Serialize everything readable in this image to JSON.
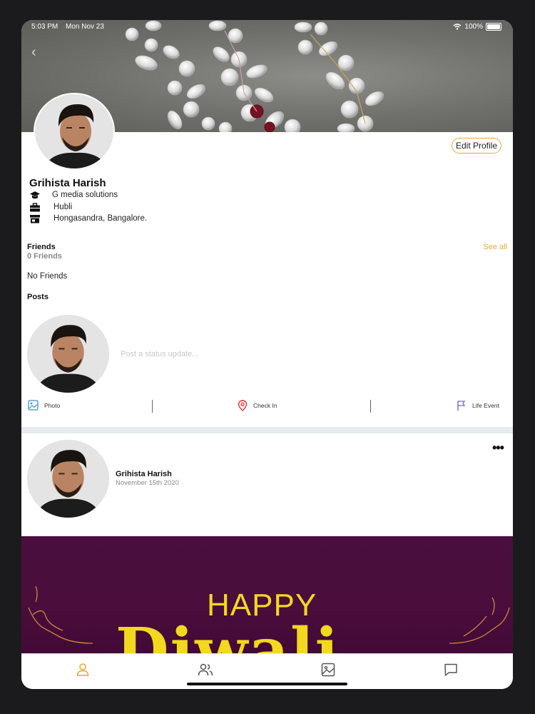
{
  "status_bar": {
    "time": "5:03 PM",
    "date": "Mon Nov 23",
    "battery": "100%"
  },
  "profile": {
    "name": "Grihista Harish",
    "edit_label": "Edit Profile",
    "info": [
      {
        "icon": "education-icon",
        "text": "G media solutions"
      },
      {
        "icon": "briefcase-icon",
        "text": "Hubli"
      },
      {
        "icon": "store-icon",
        "text": "Hongasandra, Bangalore."
      }
    ]
  },
  "friends": {
    "title": "Friends",
    "count": "0 Friends",
    "see_all": "See all",
    "empty": "No Friends"
  },
  "posts": {
    "title": "Posts",
    "placeholder": "Post a status update...",
    "actions": {
      "photo": "Photo",
      "check_in": "Check In",
      "life_event": "Life Event"
    }
  },
  "post": {
    "author": "Grihista Harish",
    "date": "November 15th 2020",
    "image_text": "HAPPY"
  },
  "tabs": [
    "profile-tab",
    "friends-tab",
    "gallery-tab",
    "chat-tab"
  ],
  "colors": {
    "accent": "#e6a93a",
    "checkin": "#e0312e",
    "photo": "#3a8fd6"
  }
}
